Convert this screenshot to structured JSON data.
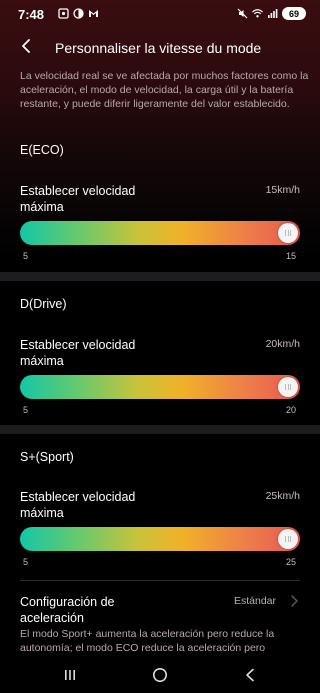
{
  "status_bar": {
    "time": "7:48",
    "battery": "69"
  },
  "header": {
    "title": "Personnaliser la vitesse du mode"
  },
  "description": "La velocidad real se ve afectada por muchos factores como la aceleración, el modo de velocidad, la carga útil y la batería restante, y puede diferir ligeramente del valor establecido.",
  "modes": [
    {
      "title": "E(ECO)",
      "setting_label": "Establecer velocidad máxima",
      "value_text": "15km/h",
      "min": "5",
      "max": "15",
      "level": 1.0
    },
    {
      "title": "D(Drive)",
      "setting_label": "Establecer velocidad máxima",
      "value_text": "20km/h",
      "min": "5",
      "max": "20",
      "level": 1.0
    },
    {
      "title": "S+(Sport)",
      "setting_label": "Establecer velocidad máxima",
      "value_text": "25km/h",
      "min": "5",
      "max": "25",
      "level": 1.0
    }
  ],
  "acceleration": {
    "label": "Configuración de aceleración",
    "value": "Estándar",
    "description": "El modo Sport+ aumenta la aceleración pero reduce la autonomía; el modo ECO reduce la aceleración pero"
  },
  "colors": {
    "slider_start": "#13c7a6",
    "slider_mid": "#f1b128",
    "slider_end": "#e8584f",
    "header_background": "#3a0d10"
  },
  "icons": {
    "back": "back-arrow-icon",
    "chevron": "chevron-right-icon",
    "nav_recents": "recents-icon",
    "nav_home": "home-icon",
    "nav_back": "nav-back-icon"
  }
}
